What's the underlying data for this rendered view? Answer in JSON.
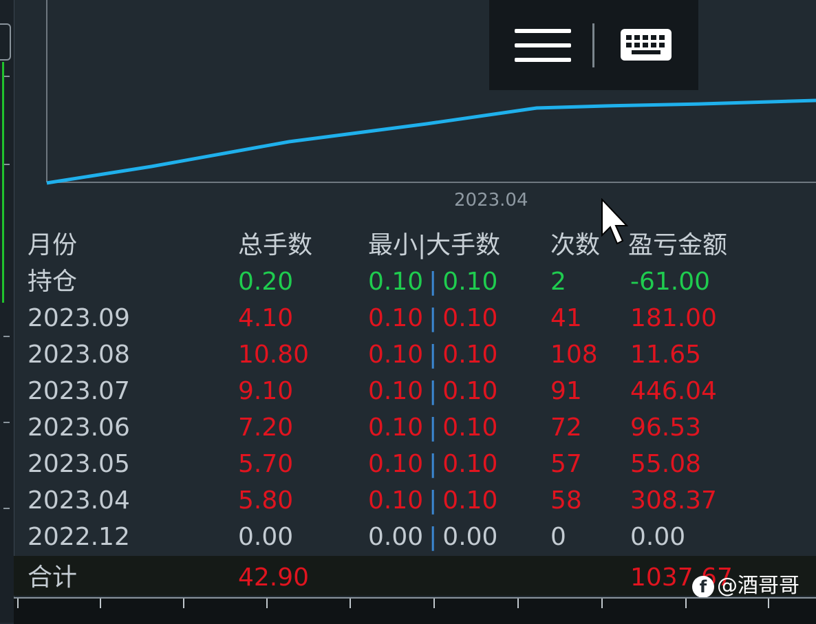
{
  "chart": {
    "x_label": "2023.04",
    "line_color": "#1fb0ec"
  },
  "toolbar": {
    "menu_icon": "hamburger-menu-icon",
    "keyboard_icon": "keyboard-icon"
  },
  "table": {
    "headers": {
      "month": "月份",
      "total_lots": "总手数",
      "min_max_lots": "最小|大手数",
      "count": "次数",
      "pnl": "盈亏金额"
    },
    "rows": [
      {
        "month": "持仓",
        "total": "0.20",
        "min": "0.10",
        "max": "0.10",
        "count": "2",
        "pnl": "-61.00",
        "color": "#1fcc4f"
      },
      {
        "month": "2023.09",
        "total": "4.10",
        "min": "0.10",
        "max": "0.10",
        "count": "41",
        "pnl": "181.00",
        "color": "#e0141f"
      },
      {
        "month": "2023.08",
        "total": "10.80",
        "min": "0.10",
        "max": "0.10",
        "count": "108",
        "pnl": "11.65",
        "color": "#e0141f"
      },
      {
        "month": "2023.07",
        "total": "9.10",
        "min": "0.10",
        "max": "0.10",
        "count": "91",
        "pnl": "446.04",
        "color": "#e0141f"
      },
      {
        "month": "2023.06",
        "total": "7.20",
        "min": "0.10",
        "max": "0.10",
        "count": "72",
        "pnl": "96.53",
        "color": "#e0141f"
      },
      {
        "month": "2023.05",
        "total": "5.70",
        "min": "0.10",
        "max": "0.10",
        "count": "57",
        "pnl": "55.08",
        "color": "#e0141f"
      },
      {
        "month": "2023.04",
        "total": "5.80",
        "min": "0.10",
        "max": "0.10",
        "count": "58",
        "pnl": "308.37",
        "color": "#e0141f"
      },
      {
        "month": "2022.12",
        "total": "0.00",
        "min": "0.00",
        "max": "0.00",
        "count": "0",
        "pnl": "0.00",
        "color": "#c3cbd2"
      }
    ],
    "total_row": {
      "label": "合计",
      "total": "42.90",
      "pnl": "1037.67"
    },
    "separator": "|"
  },
  "watermark": {
    "logo": "f",
    "text": "@酒哥哥"
  }
}
